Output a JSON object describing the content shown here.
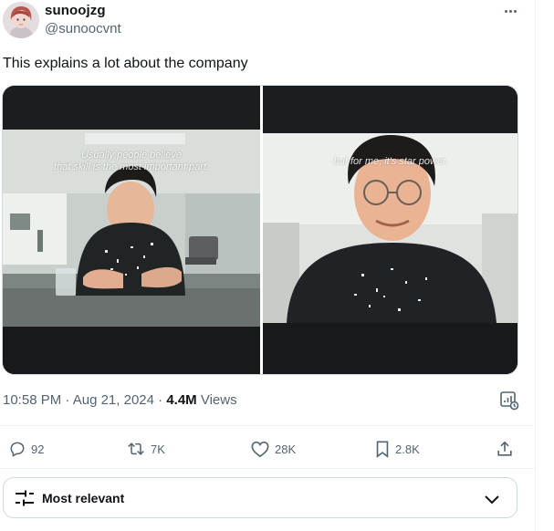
{
  "author": {
    "display_name": "sunoojzg",
    "handle": "@sunoocvnt"
  },
  "tweet": {
    "text": "This explains a lot about the company"
  },
  "media": {
    "left_subtitle_line1": "Usually people believe",
    "left_subtitle_line2": "that skill is the most important part,",
    "right_subtitle": "but for me, it's star power."
  },
  "meta": {
    "time": "10:58 PM",
    "separator": "·",
    "date": "Aug 21, 2024",
    "views_count": "4.4M",
    "views_label": "Views"
  },
  "actions": {
    "replies": "92",
    "reposts": "7K",
    "likes": "28K",
    "bookmarks": "2.8K"
  },
  "sort": {
    "label": "Most relevant"
  },
  "colors": {
    "text_primary": "#0f1419",
    "text_secondary": "#536471",
    "border": "#cfd9de"
  },
  "icons": [
    "more-icon",
    "analytics-icon",
    "reply-icon",
    "repost-icon",
    "like-icon",
    "bookmark-icon",
    "share-icon",
    "sort-sliders-icon",
    "chevron-down-icon"
  ]
}
